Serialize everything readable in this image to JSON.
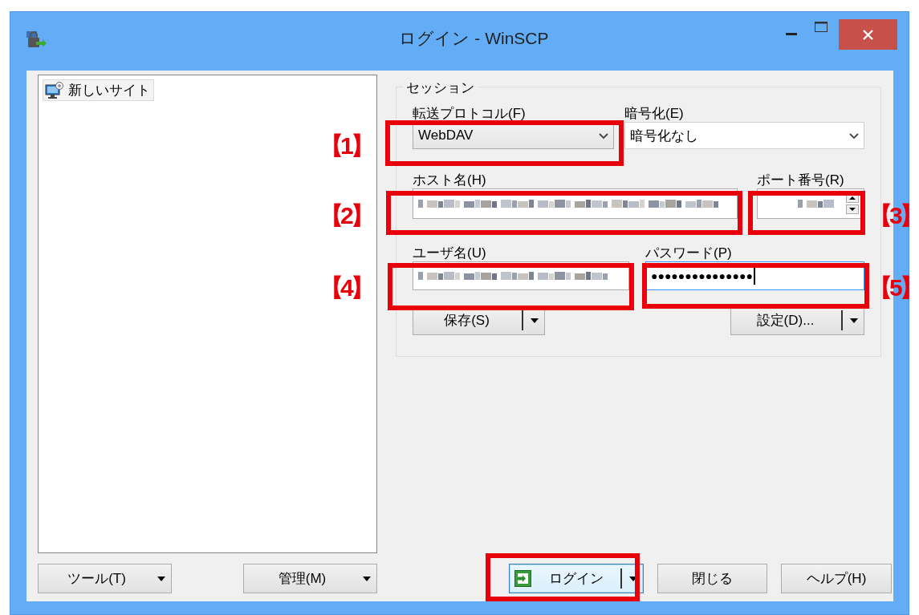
{
  "window": {
    "title": "ログイン - WinSCP"
  },
  "site_tree": {
    "items": [
      {
        "label": "新しいサイト",
        "selected": true
      }
    ]
  },
  "session": {
    "legend": "セッション",
    "protocol": {
      "label": "転送プロトコル(F)",
      "value": "WebDAV"
    },
    "encryption": {
      "label": "暗号化(E)",
      "value": "暗号化なし"
    },
    "host": {
      "label": "ホスト名(H)",
      "blurred": true
    },
    "port": {
      "label": "ポート番号(R)",
      "blurred": true
    },
    "user": {
      "label": "ユーザ名(U)",
      "blurred": true
    },
    "password": {
      "label": "パスワード(P)",
      "value": "●●●●●●●●●●●●●●●",
      "focused": true,
      "blurred": false
    },
    "buttons": [
      {
        "label": "保存(S)",
        "kind": "split"
      },
      {
        "label": "設定(D)...",
        "kind": "split"
      }
    ]
  },
  "bottom_left_buttons": [
    {
      "label": "ツール(T)",
      "kind": "menu"
    },
    {
      "label": "管理(M)",
      "kind": "menu"
    }
  ],
  "bottom_right_buttons": [
    {
      "label": "ログイン",
      "kind": "login",
      "default": true
    },
    {
      "label": "閉じる",
      "kind": "plain",
      "default": false
    },
    {
      "label": "ヘルプ(H)",
      "kind": "plain",
      "default": false
    }
  ],
  "annotations": [
    {
      "kind": "numbered",
      "number": "【1】"
    },
    {
      "kind": "numbered",
      "number": "【2】"
    },
    {
      "kind": "numbered",
      "number": "【3】"
    },
    {
      "kind": "numbered",
      "number": "【4】"
    },
    {
      "kind": "numbered",
      "number": "【5】"
    },
    {
      "kind": "box"
    }
  ]
}
